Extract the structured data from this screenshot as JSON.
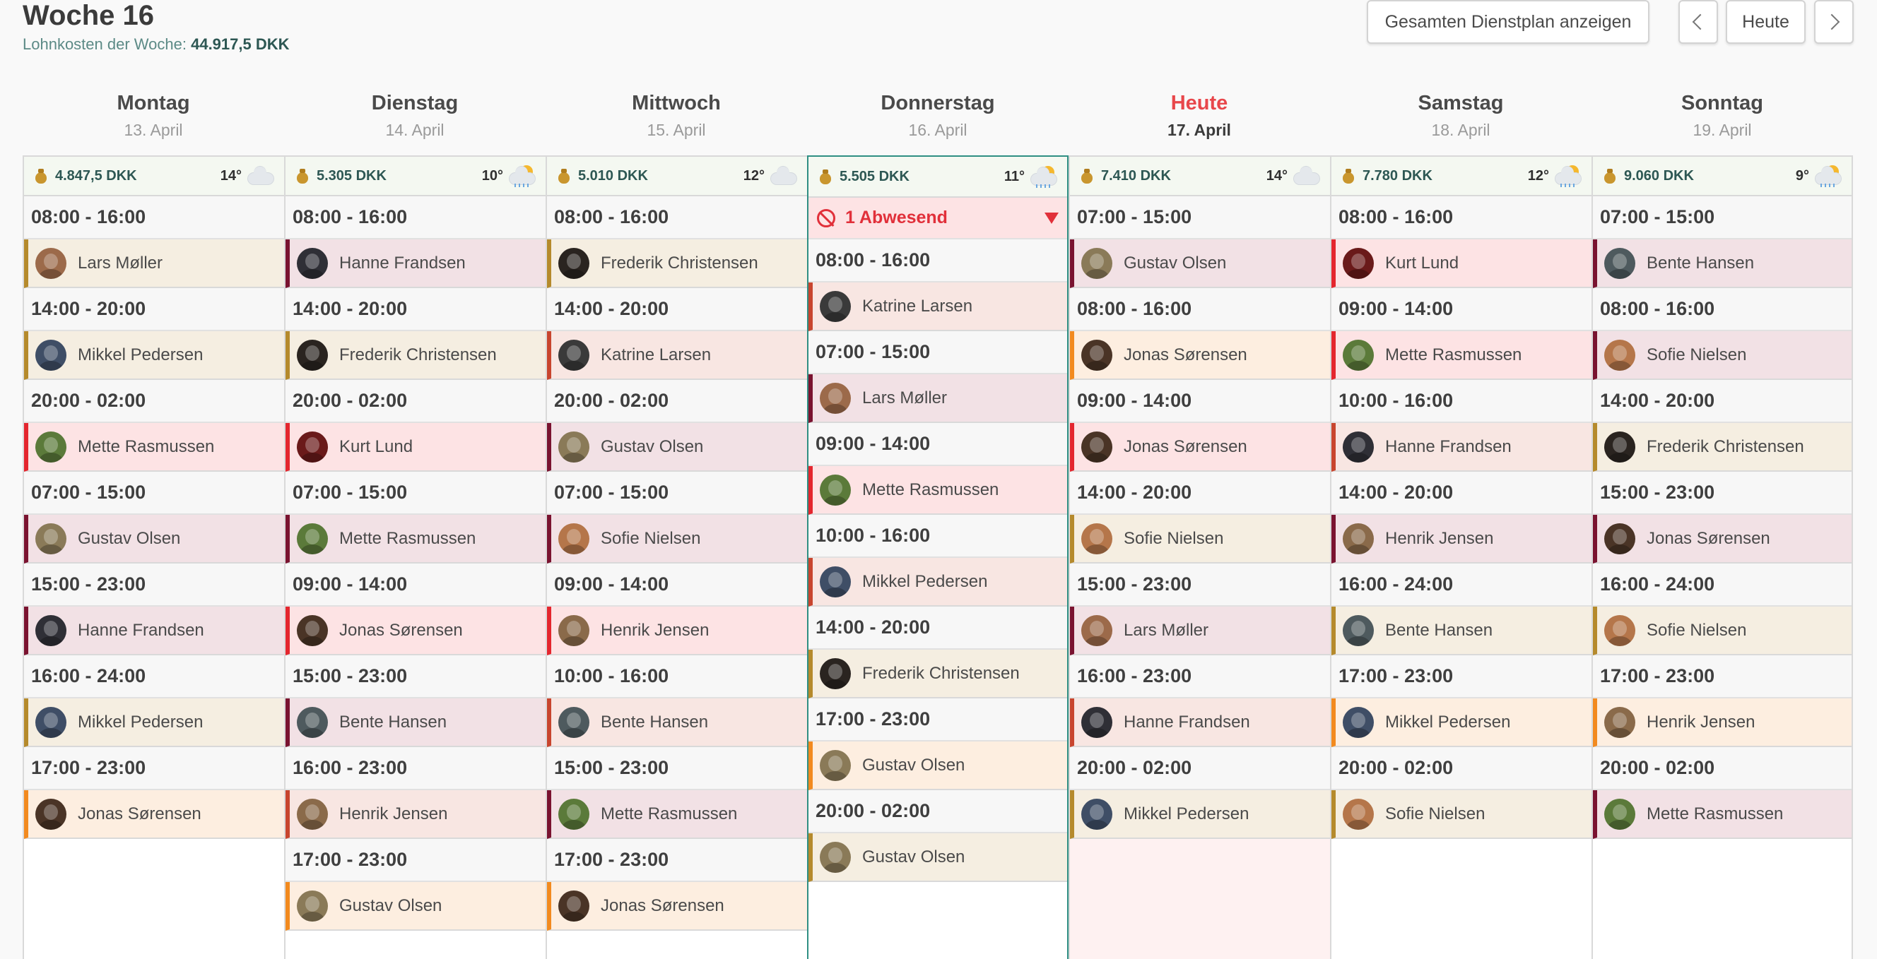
{
  "header": {
    "title": "Woche 16",
    "wage_label": "Lohnkosten der Woche:",
    "wage_value": "44.917,5 DKK",
    "full_plan_button": "Gesamten Dienstplan anzeigen",
    "today_button": "Heute"
  },
  "colors": {
    "accent_teal": "#2f8f83",
    "today_red": "#e8474b",
    "absent_red": "#e1303a"
  },
  "days": [
    {
      "name": "Montag",
      "date": "13. April",
      "cost": "4.847,5 DKK",
      "temp": "14°",
      "weather": "cloud-icon",
      "shifts": [
        {
          "time": "08:00 - 16:00",
          "employee": "Lars Møller",
          "bg": "#f5eee1",
          "bar": "#b58a2c",
          "avatar": "#9c6a4a"
        },
        {
          "time": "14:00 - 20:00",
          "employee": "Mikkel Pedersen",
          "bg": "#f5eee1",
          "bar": "#b58a2c",
          "avatar": "#3f4e66"
        },
        {
          "time": "20:00 - 02:00",
          "employee": "Mette Rasmussen",
          "bg": "#fde3e4",
          "bar": "#e4262e",
          "avatar": "#5b7a3a"
        },
        {
          "time": "07:00 - 15:00",
          "employee": "Gustav Olsen",
          "bg": "#f2e1e5",
          "bar": "#7a1330",
          "avatar": "#8a7a58"
        },
        {
          "time": "15:00 - 23:00",
          "employee": "Hanne Frandsen",
          "bg": "#f2e1e5",
          "bar": "#7a1330",
          "avatar": "#2f2f36"
        },
        {
          "time": "16:00 - 24:00",
          "employee": "Mikkel Pedersen",
          "bg": "#f5eee1",
          "bar": "#b58a2c",
          "avatar": "#3f4e66"
        },
        {
          "time": "17:00 - 23:00",
          "employee": "Jonas Sørensen",
          "bg": "#fdeee0",
          "bar": "#f28a1f",
          "avatar": "#4a3426"
        }
      ]
    },
    {
      "name": "Dienstag",
      "date": "14. April",
      "cost": "5.305 DKK",
      "temp": "10°",
      "weather": "sun-rain-icon",
      "shifts": [
        {
          "time": "08:00 - 16:00",
          "employee": "Hanne Frandsen",
          "bg": "#f2e1e5",
          "bar": "#7a1330",
          "avatar": "#2f2f36"
        },
        {
          "time": "14:00 - 20:00",
          "employee": "Frederik Christensen",
          "bg": "#f5eee1",
          "bar": "#b58a2c",
          "avatar": "#2a2420"
        },
        {
          "time": "20:00 - 02:00",
          "employee": "Kurt Lund",
          "bg": "#fde3e4",
          "bar": "#e4262e",
          "avatar": "#6a1a1a"
        },
        {
          "time": "07:00 - 15:00",
          "employee": "Mette Rasmussen",
          "bg": "#f2e1e5",
          "bar": "#7a1330",
          "avatar": "#5b7a3a"
        },
        {
          "time": "09:00 - 14:00",
          "employee": "Jonas Sørensen",
          "bg": "#fde3e4",
          "bar": "#e4262e",
          "avatar": "#4a3426"
        },
        {
          "time": "15:00 - 23:00",
          "employee": "Bente Hansen",
          "bg": "#f2e1e5",
          "bar": "#7a1330",
          "avatar": "#4e5a5e"
        },
        {
          "time": "16:00 - 23:00",
          "employee": "Henrik Jensen",
          "bg": "#f8e6e2",
          "bar": "#c8452e",
          "avatar": "#8a6a4a"
        },
        {
          "time": "17:00 - 23:00",
          "employee": "Gustav Olsen",
          "bg": "#fdeee0",
          "bar": "#f28a1f",
          "avatar": "#8a7a58"
        }
      ]
    },
    {
      "name": "Mittwoch",
      "date": "15. April",
      "cost": "5.010 DKK",
      "temp": "12°",
      "weather": "cloud-icon",
      "shifts": [
        {
          "time": "08:00 - 16:00",
          "employee": "Frederik Christensen",
          "bg": "#f5eee1",
          "bar": "#b58a2c",
          "avatar": "#2a2420"
        },
        {
          "time": "14:00 - 20:00",
          "employee": "Katrine Larsen",
          "bg": "#f8e6e2",
          "bar": "#c8452e",
          "avatar": "#3a3a3a"
        },
        {
          "time": "20:00 - 02:00",
          "employee": "Gustav Olsen",
          "bg": "#f2e1e5",
          "bar": "#7a1330",
          "avatar": "#8a7a58"
        },
        {
          "time": "07:00 - 15:00",
          "employee": "Sofie Nielsen",
          "bg": "#f2e1e5",
          "bar": "#7a1330",
          "avatar": "#b5764a"
        },
        {
          "time": "09:00 - 14:00",
          "employee": "Henrik Jensen",
          "bg": "#fde3e4",
          "bar": "#e4262e",
          "avatar": "#8a6a4a"
        },
        {
          "time": "10:00 - 16:00",
          "employee": "Bente Hansen",
          "bg": "#f8e6e2",
          "bar": "#c8452e",
          "avatar": "#4e5a5e"
        },
        {
          "time": "15:00 - 23:00",
          "employee": "Mette Rasmussen",
          "bg": "#f2e1e5",
          "bar": "#7a1330",
          "avatar": "#5b7a3a"
        },
        {
          "time": "17:00 - 23:00",
          "employee": "Jonas Sørensen",
          "bg": "#fdeee0",
          "bar": "#f28a1f",
          "avatar": "#4a3426"
        }
      ]
    },
    {
      "name": "Donnerstag",
      "date": "16. April",
      "cost": "5.505 DKK",
      "temp": "11°",
      "weather": "sun-rain-icon",
      "absent": "1 Abwesend",
      "shifts": [
        {
          "time": "08:00 - 16:00",
          "employee": "Katrine Larsen",
          "bg": "#f8e6e2",
          "bar": "#c8452e",
          "avatar": "#3a3a3a"
        },
        {
          "time": "07:00 - 15:00",
          "employee": "Lars Møller",
          "bg": "#f2e1e5",
          "bar": "#7a1330",
          "avatar": "#9c6a4a"
        },
        {
          "time": "09:00 - 14:00",
          "employee": "Mette Rasmussen",
          "bg": "#fde3e4",
          "bar": "#e4262e",
          "avatar": "#5b7a3a"
        },
        {
          "time": "10:00 - 16:00",
          "employee": "Mikkel Pedersen",
          "bg": "#f8e6e2",
          "bar": "#c8452e",
          "avatar": "#3f4e66"
        },
        {
          "time": "14:00 - 20:00",
          "employee": "Frederik Christensen",
          "bg": "#f5eee1",
          "bar": "#b58a2c",
          "avatar": "#2a2420"
        },
        {
          "time": "17:00 - 23:00",
          "employee": "Gustav Olsen",
          "bg": "#fdeee0",
          "bar": "#f28a1f",
          "avatar": "#8a7a58"
        },
        {
          "time": "20:00 - 02:00",
          "employee": "Gustav Olsen",
          "bg": "#f5eee1",
          "bar": "#b58a2c",
          "avatar": "#8a7a58"
        }
      ]
    },
    {
      "name": "Heute",
      "date": "17. April",
      "cost": "7.410 DKK",
      "temp": "14°",
      "weather": "cloud-icon",
      "shifts": [
        {
          "time": "07:00 - 15:00",
          "employee": "Gustav Olsen",
          "bg": "#f2e1e5",
          "bar": "#7a1330",
          "avatar": "#8a7a58"
        },
        {
          "time": "08:00 - 16:00",
          "employee": "Jonas Sørensen",
          "bg": "#fdeee0",
          "bar": "#f28a1f",
          "avatar": "#4a3426"
        },
        {
          "time": "09:00 - 14:00",
          "employee": "Jonas Sørensen",
          "bg": "#fde3e4",
          "bar": "#e4262e",
          "avatar": "#4a3426"
        },
        {
          "time": "14:00 - 20:00",
          "employee": "Sofie Nielsen",
          "bg": "#f5eee1",
          "bar": "#b58a2c",
          "avatar": "#b5764a"
        },
        {
          "time": "15:00 - 23:00",
          "employee": "Lars Møller",
          "bg": "#f2e1e5",
          "bar": "#7a1330",
          "avatar": "#9c6a4a"
        },
        {
          "time": "16:00 - 23:00",
          "employee": "Hanne Frandsen",
          "bg": "#f8e6e2",
          "bar": "#c8452e",
          "avatar": "#2f2f36"
        },
        {
          "time": "20:00 - 02:00",
          "employee": "Mikkel Pedersen",
          "bg": "#f5eee1",
          "bar": "#b58a2c",
          "avatar": "#3f4e66"
        }
      ]
    },
    {
      "name": "Samstag",
      "date": "18. April",
      "cost": "7.780 DKK",
      "temp": "12°",
      "weather": "sun-rain-icon",
      "shifts": [
        {
          "time": "08:00 - 16:00",
          "employee": "Kurt Lund",
          "bg": "#fde3e4",
          "bar": "#e4262e",
          "avatar": "#6a1a1a"
        },
        {
          "time": "09:00 - 14:00",
          "employee": "Mette Rasmussen",
          "bg": "#fde3e4",
          "bar": "#e4262e",
          "avatar": "#5b7a3a"
        },
        {
          "time": "10:00 - 16:00",
          "employee": "Hanne Frandsen",
          "bg": "#f8e6e2",
          "bar": "#c8452e",
          "avatar": "#2f2f36"
        },
        {
          "time": "14:00 - 20:00",
          "employee": "Henrik Jensen",
          "bg": "#f2e1e5",
          "bar": "#7a1330",
          "avatar": "#8a6a4a"
        },
        {
          "time": "16:00 - 24:00",
          "employee": "Bente Hansen",
          "bg": "#f5eee1",
          "bar": "#b58a2c",
          "avatar": "#4e5a5e"
        },
        {
          "time": "17:00 - 23:00",
          "employee": "Mikkel Pedersen",
          "bg": "#fdeee0",
          "bar": "#f28a1f",
          "avatar": "#3f4e66"
        },
        {
          "time": "20:00 - 02:00",
          "employee": "Sofie Nielsen",
          "bg": "#f5eee1",
          "bar": "#b58a2c",
          "avatar": "#b5764a"
        }
      ]
    },
    {
      "name": "Sonntag",
      "date": "19. April",
      "cost": "9.060 DKK",
      "temp": "9°",
      "weather": "sun-rain-icon",
      "shifts": [
        {
          "time": "07:00 - 15:00",
          "employee": "Bente Hansen",
          "bg": "#f2e1e5",
          "bar": "#7a1330",
          "avatar": "#4e5a5e"
        },
        {
          "time": "08:00 - 16:00",
          "employee": "Sofie Nielsen",
          "bg": "#f2e1e5",
          "bar": "#7a1330",
          "avatar": "#b5764a"
        },
        {
          "time": "14:00 - 20:00",
          "employee": "Frederik Christensen",
          "bg": "#f5eee1",
          "bar": "#b58a2c",
          "avatar": "#2a2420"
        },
        {
          "time": "15:00 - 23:00",
          "employee": "Jonas Sørensen",
          "bg": "#f2e1e5",
          "bar": "#7a1330",
          "avatar": "#4a3426"
        },
        {
          "time": "16:00 - 24:00",
          "employee": "Sofie Nielsen",
          "bg": "#f5eee1",
          "bar": "#b58a2c",
          "avatar": "#b5764a"
        },
        {
          "time": "17:00 - 23:00",
          "employee": "Henrik Jensen",
          "bg": "#fdeee0",
          "bar": "#f28a1f",
          "avatar": "#8a6a4a"
        },
        {
          "time": "20:00 - 02:00",
          "employee": "Mette Rasmussen",
          "bg": "#f2e1e5",
          "bar": "#7a1330",
          "avatar": "#5b7a3a"
        }
      ]
    }
  ]
}
